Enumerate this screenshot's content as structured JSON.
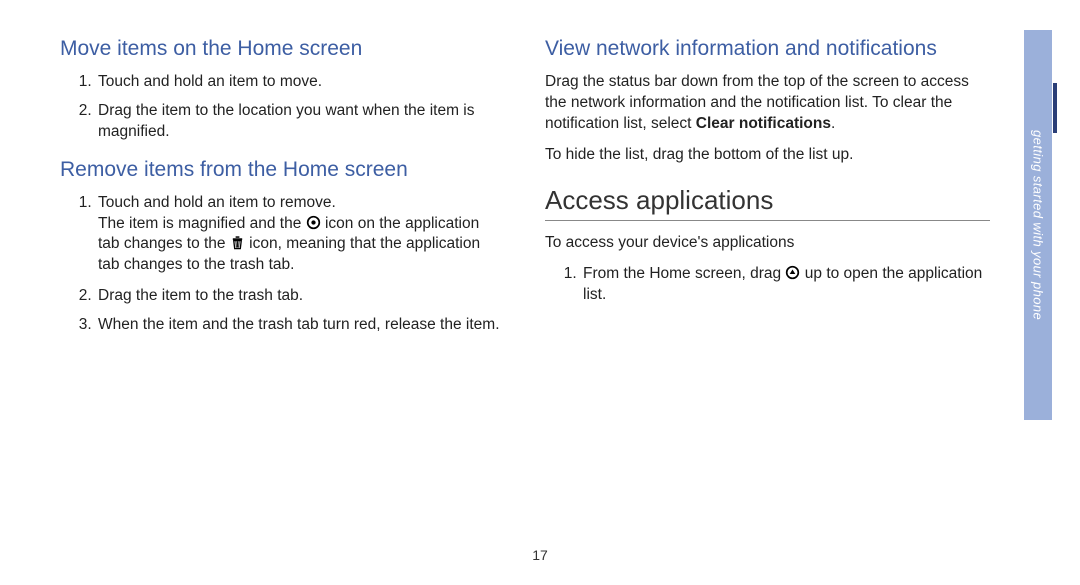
{
  "left": {
    "section1": {
      "title": "Move items on the Home screen",
      "steps": [
        "Touch and hold an item to move.",
        "Drag the item to the location you want when the item is magnified."
      ]
    },
    "section2": {
      "title": "Remove items from the Home screen",
      "step1": "Touch and hold an item to remove.",
      "sub_a": "The item is magnified and the ",
      "sub_b": " icon on the application tab changes to the ",
      "sub_c": " icon, meaning that the application tab changes to the trash tab.",
      "step2": "Drag the item to the trash tab.",
      "step3": "When the item and the trash tab turn red, release the item."
    }
  },
  "right": {
    "section1": {
      "title": "View network information and notifications",
      "p1_a": "Drag the status bar down from the top of the screen to access the network information and the notification list. To clear the notification list, select ",
      "p1_b": "Clear notifications",
      "p1_c": ".",
      "p2": "To hide the list, drag the bottom of the list up."
    },
    "section2": {
      "title": "Access applications",
      "intro": "To access your device's applications",
      "step1_a": "From the Home screen, drag ",
      "step1_b": " up to open the application list."
    }
  },
  "side_tab": "getting started with your phone",
  "page_number": "17"
}
